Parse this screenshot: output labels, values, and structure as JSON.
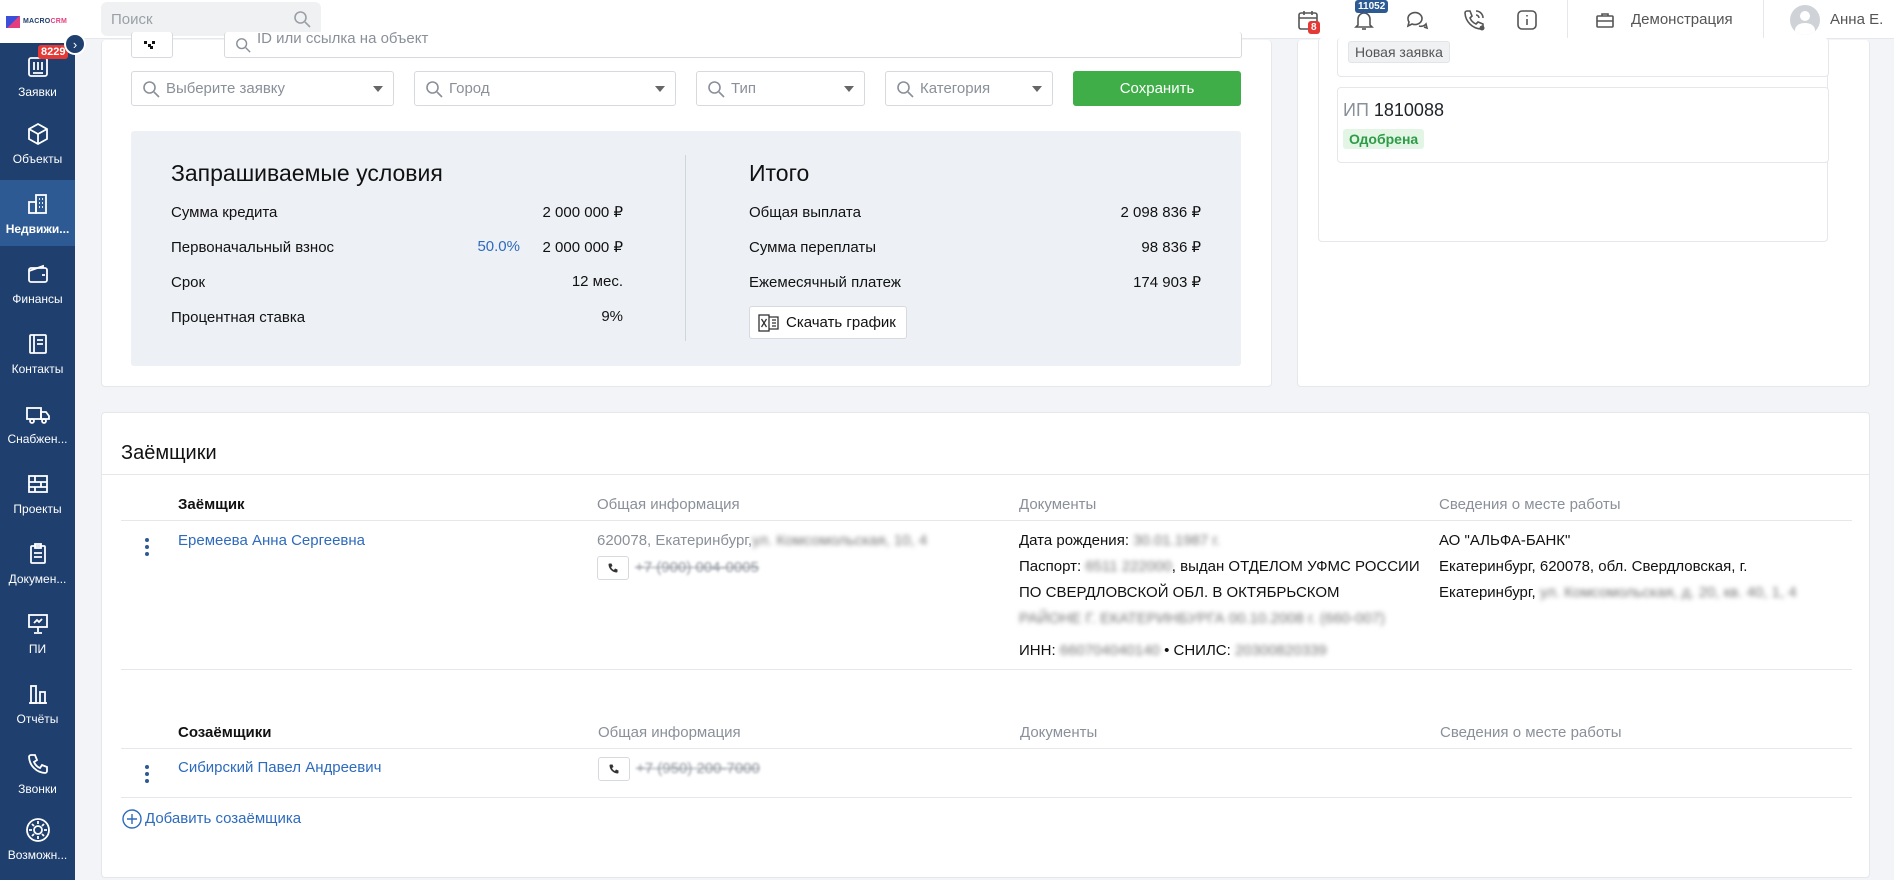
{
  "app": {
    "logo_prefix": "MACRO",
    "logo_suffix": "CRM"
  },
  "sidebar": {
    "collapse_glyph": "›",
    "items": [
      {
        "label": "Заявки",
        "icon": "requests-icon",
        "badge": "8229"
      },
      {
        "label": "Объекты",
        "icon": "cube-icon"
      },
      {
        "label": "Недвижи...",
        "icon": "buildings-icon",
        "active": true
      },
      {
        "label": "Финансы",
        "icon": "wallet-icon"
      },
      {
        "label": "Контакты",
        "icon": "contacts-icon"
      },
      {
        "label": "Снабжен...",
        "icon": "truck-icon"
      },
      {
        "label": "Проекты",
        "icon": "projects-icon"
      },
      {
        "label": "Докумен...",
        "icon": "clipboard-icon"
      },
      {
        "label": "ПИ",
        "icon": "presentation-icon"
      },
      {
        "label": "Отчёты",
        "icon": "chart-icon"
      },
      {
        "label": "Звонки",
        "icon": "phone-icon"
      },
      {
        "label": "Возможн...",
        "icon": "gear-icon"
      }
    ]
  },
  "topbar": {
    "search_placeholder": "Поиск",
    "calendar_badge": "8",
    "notifications_badge": "11052",
    "demo_label": "Демонстрация",
    "user_name": "Анна Е."
  },
  "filters": {
    "id_placeholder": "ID или ссылка на объект",
    "request": "Выберите заявку",
    "city": "Город",
    "type": "Тип",
    "category": "Категория",
    "save_label": "Сохранить"
  },
  "requested": {
    "title": "Запрашиваемые условия",
    "rows": [
      {
        "label": "Сумма кредита",
        "value": "2 000 000 ₽"
      },
      {
        "label": "Первоначальный взнос",
        "percent": "50.0%",
        "value": "2 000 000 ₽"
      },
      {
        "label": "Срок",
        "value": "12 мес."
      },
      {
        "label": "Процентная ставка",
        "value": "9%"
      }
    ]
  },
  "total": {
    "title": "Итого",
    "rows": [
      {
        "label": "Общая выплата",
        "value": "2 098 836 ₽"
      },
      {
        "label": "Сумма переплаты",
        "value": "98 836 ₽"
      },
      {
        "label": "Ежемесячный платеж",
        "value": "174 903 ₽"
      }
    ],
    "download_label": "Скачать график"
  },
  "right_panel": {
    "new_request_tag": "Новая заявка",
    "ip_prefix": "ИП",
    "ip_number": "1810088",
    "approved_tag": "Одобрена"
  },
  "borrowers": {
    "title": "Заёмщики",
    "headers": [
      "Заёмщик",
      "Общая информация",
      "Документы",
      "Сведения о месте работы"
    ],
    "main": {
      "name": "Еремеева Анна Сергеевна",
      "address": "620078, Екатеринбург,",
      "address_hidden": "ул. Комсомольская, 10, 4",
      "phone": "+7 (900) 004-0005",
      "birth_label": "Дата рождения:",
      "birth_value": "30.01.1987 г.",
      "passport_label": "Паспорт:",
      "passport_number": "6511 222000",
      "passport_issued": ", выдан ОТДЕЛОМ УФМС РОССИИ ПО СВЕРДЛОВСКОЙ ОБЛ. В ОКТЯБРЬСКОМ",
      "passport_hidden": "РАЙОНЕ Г. ЕКАТЕРИНБУРГА 00.10.2008 г. (660-007)",
      "inn_label": "ИНН:",
      "inn_value": "660704040140",
      "snils_label": "• СНИЛС:",
      "snils_value": "20300820339",
      "work_company": "АО \"АЛЬФА-БАНК\"",
      "work_address": "Екатеринбург, 620078, обл. Свердловская, г. Екатеринбург,",
      "work_hidden": "ул. Комсомольская, д. 20, кв. 40, 1, 4"
    },
    "co_headers": [
      "Созаёмщики",
      "Общая информация",
      "Документы",
      "Сведения о месте работы"
    ],
    "co": {
      "name": "Сибирский Павел Андреевич",
      "phone": "+7 (950) 200-7000"
    },
    "add_co_label": "Добавить созаёмщика"
  }
}
